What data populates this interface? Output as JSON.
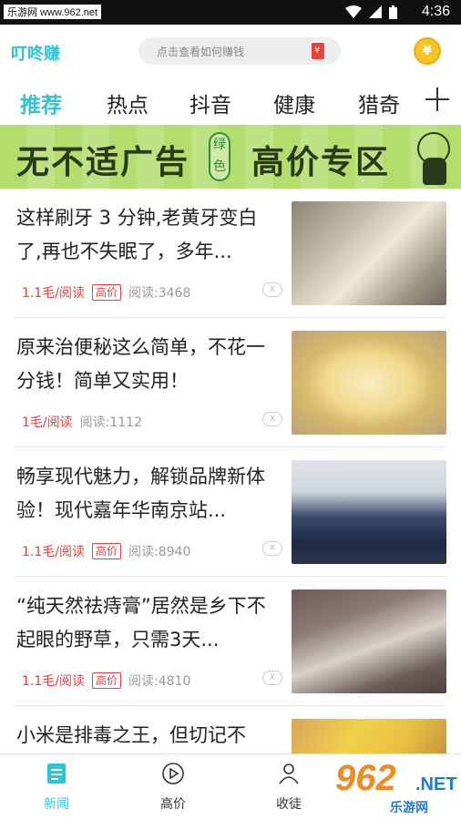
{
  "status_bar": {
    "watermark": "乐游网 www.962.net",
    "time": "4:36"
  },
  "app_bar": {
    "brand": "叮咚赚",
    "search_placeholder": "点击查看如何赚钱"
  },
  "tabs": [
    {
      "label": "推荐",
      "active": true
    },
    {
      "label": "热点"
    },
    {
      "label": "抖音"
    },
    {
      "label": "健康"
    },
    {
      "label": "猎奇"
    }
  ],
  "banner": {
    "left_text": "无不适广告",
    "badge_text": "绿色",
    "right_text": "高价专区"
  },
  "feed": [
    {
      "title": "这样刷牙 3 分钟,老黄牙变白了,再也不失眠了，多年...",
      "price": "1.1毛/阅读",
      "tag": "高价",
      "reads": "阅读:3468"
    },
    {
      "title": "原来治便秘这么简单，不花一分钱！简单又实用！",
      "price": "1毛/阅读",
      "tag": "",
      "reads": "阅读:1112"
    },
    {
      "title": "畅享现代魅力，解锁品牌新体验！现代嘉年华南京站...",
      "price": "1.1毛/阅读",
      "tag": "高价",
      "reads": "阅读:8940"
    },
    {
      "title": "“纯天然祛痔膏”居然是乡下不起眼的野草，只需3天...",
      "price": "1.1毛/阅读",
      "tag": "高价",
      "reads": "阅读:4810"
    },
    {
      "title": "小米是排毒之王，但切记不",
      "price": "",
      "tag": "",
      "reads": ""
    }
  ],
  "close_label": "X",
  "bottom_nav": [
    {
      "label": "新闻",
      "active": true
    },
    {
      "label": "高价"
    },
    {
      "label": "收徒"
    }
  ],
  "site_watermark": {
    "number": "962",
    "domain": ".NET",
    "name": "乐游网"
  },
  "colors": {
    "accent": "#2fc5d9",
    "price": "#e04040",
    "banner_bg": "#b3de6e"
  }
}
